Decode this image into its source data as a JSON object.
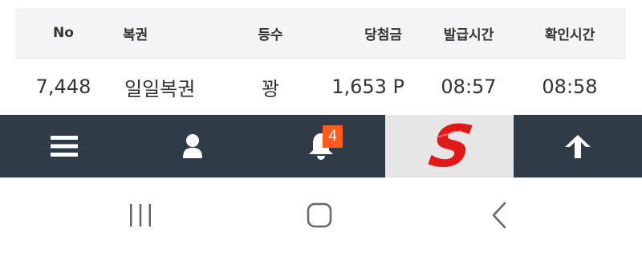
{
  "table": {
    "headers": {
      "no": "No",
      "name": "복권",
      "rank": "등수",
      "prize": "당첨금",
      "issued": "발급시간",
      "checked": "확인시간"
    },
    "rows": [
      {
        "no": "7,448",
        "name": "일일복권",
        "rank": "꽝",
        "prize": "1,653 P",
        "issued": "08:57",
        "checked": "08:58"
      }
    ]
  },
  "bottom_nav": {
    "items": [
      {
        "icon": "hamburger-menu-icon"
      },
      {
        "icon": "user-icon"
      },
      {
        "icon": "bell-icon",
        "badge": "4"
      },
      {
        "icon": "s-logo-icon"
      },
      {
        "icon": "arrow-up-icon"
      }
    ]
  },
  "colors": {
    "header_bg": "#f4f4f6",
    "bottom_bar": "#2f3b47",
    "badge": "#ff5a1f",
    "logo_red": "#e01818",
    "text": "#333333"
  }
}
